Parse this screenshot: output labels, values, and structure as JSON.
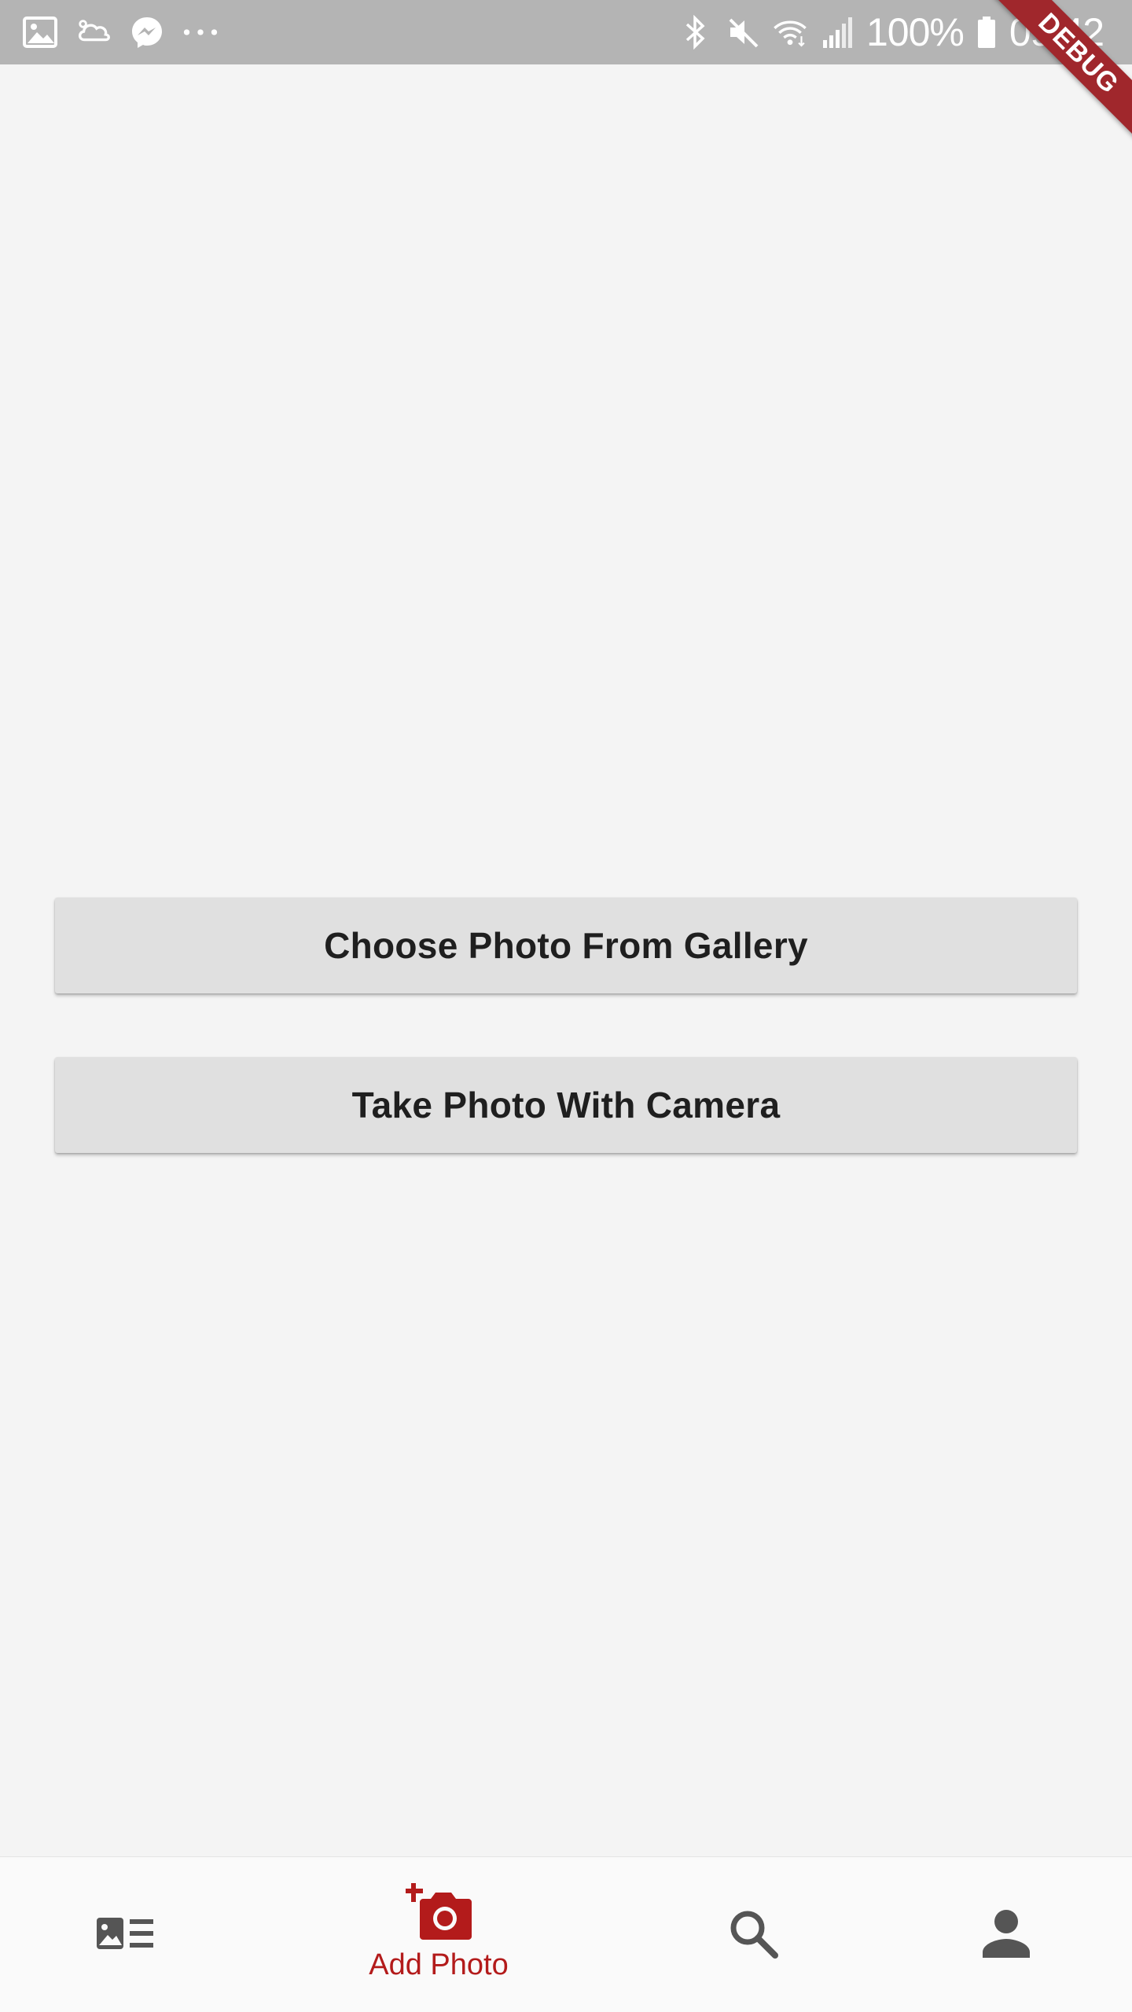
{
  "status_bar": {
    "battery": "100%",
    "time": "09:42",
    "left_icons": [
      "gallery-notification-icon",
      "cloud-notification-icon",
      "messenger-icon",
      "more-dots-icon"
    ],
    "right_icons": [
      "bluetooth-icon",
      "mute-icon",
      "wifi-icon",
      "signal-icon",
      "battery-icon"
    ]
  },
  "debug_banner": "DEBUG",
  "actions": {
    "gallery_label": "Choose Photo From Gallery",
    "camera_label": "Take Photo With Camera"
  },
  "bottom_nav": {
    "items": [
      {
        "icon": "feed-icon",
        "label": ""
      },
      {
        "icon": "add-photo-icon",
        "label": "Add Photo",
        "active": true
      },
      {
        "icon": "search-icon",
        "label": ""
      },
      {
        "icon": "profile-icon",
        "label": ""
      }
    ]
  },
  "colors": {
    "accent": "#b31b1b",
    "status_bar": "#b4b4b4",
    "background": "#f4f4f4",
    "button": "#e0e0e0",
    "icon_inactive": "#555555"
  }
}
